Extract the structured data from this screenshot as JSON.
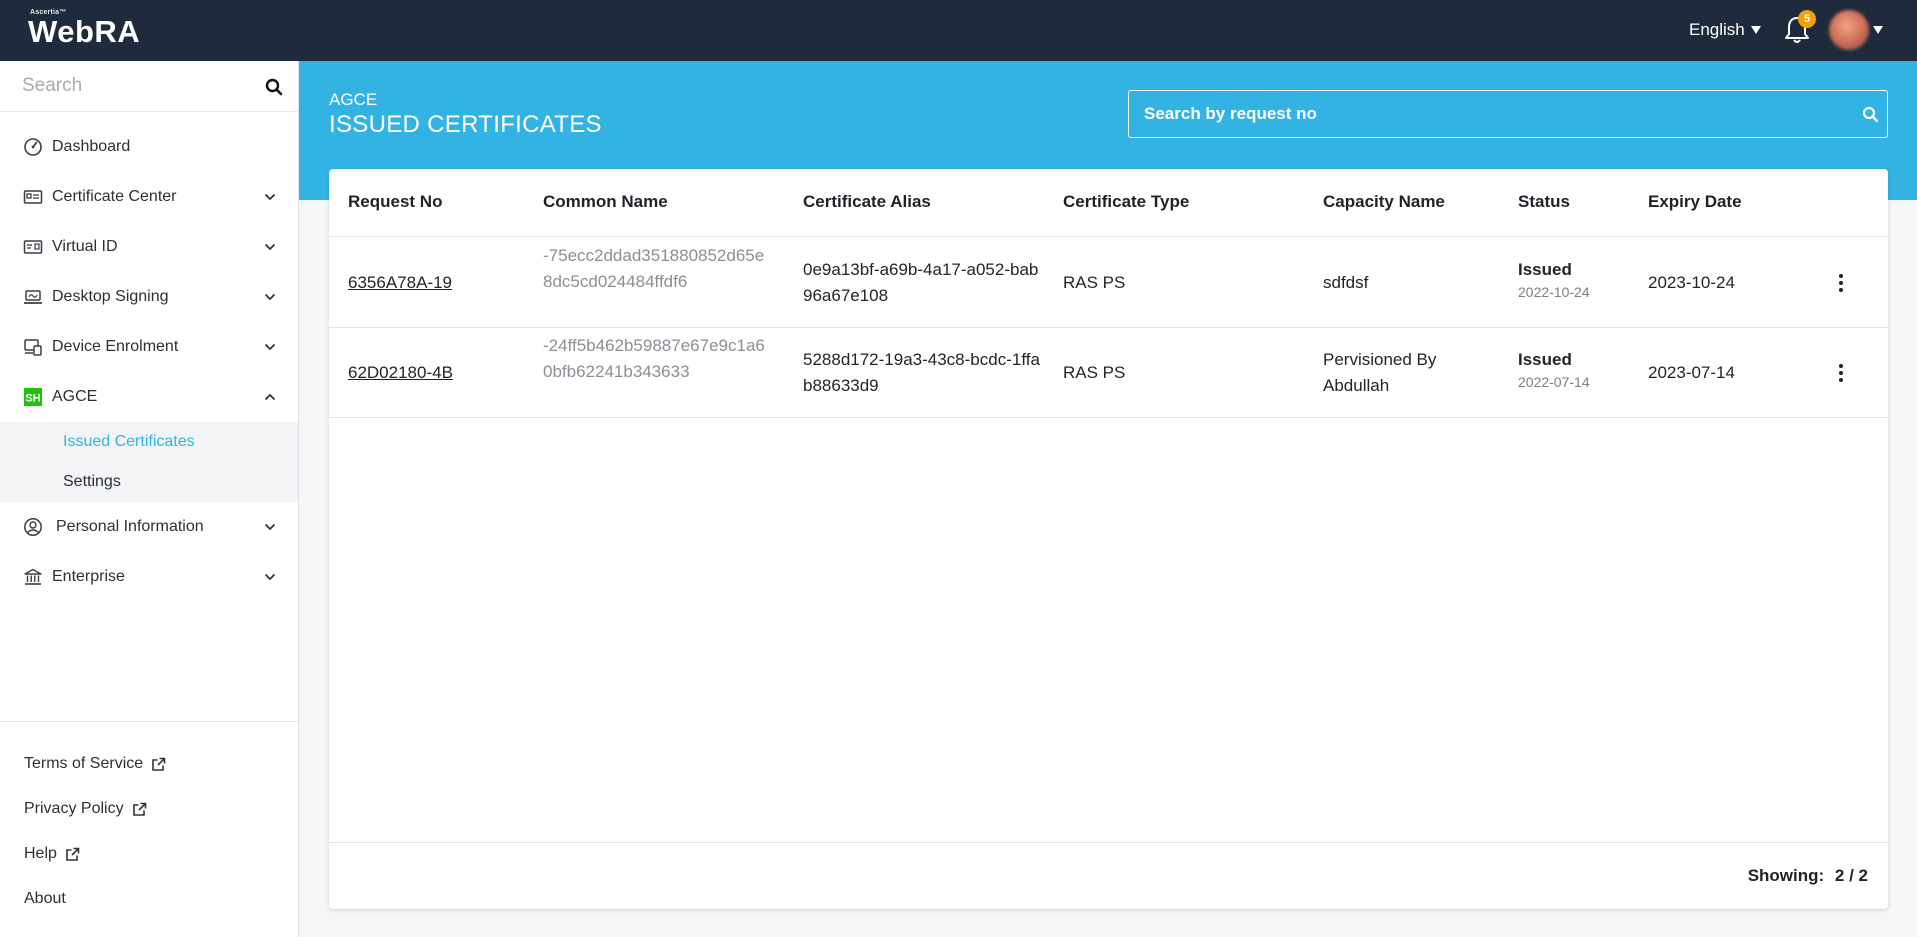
{
  "brand": {
    "small": "Ascertia™",
    "name": "WebRA"
  },
  "topbar": {
    "language": "English",
    "notifications_count": "5",
    "colors": {
      "bg": "#1f2a3c",
      "badge": "#f2a007"
    }
  },
  "sidebar": {
    "search_placeholder": "Search",
    "items": [
      {
        "label": "Dashboard",
        "icon": "dashboard-gauge-icon"
      },
      {
        "label": "Certificate Center",
        "icon": "certificate-card-icon"
      },
      {
        "label": "Virtual ID",
        "icon": "id-card-icon"
      },
      {
        "label": "Desktop Signing",
        "icon": "laptop-signing-icon"
      },
      {
        "label": "Device Enrolment",
        "icon": "device-enrolment-icon"
      },
      {
        "label": "AGCE",
        "icon": "agce-sh-icon"
      },
      {
        "label": "Personal Information",
        "icon": "user-circle-icon"
      },
      {
        "label": "Enterprise",
        "icon": "bank-building-icon"
      }
    ],
    "agce_sub": [
      {
        "label": "Issued Certificates"
      },
      {
        "label": "Settings"
      }
    ],
    "footer": [
      {
        "label": "Terms of Service"
      },
      {
        "label": "Privacy Policy"
      },
      {
        "label": "Help"
      },
      {
        "label": "About"
      }
    ],
    "colors": {
      "active": "#31b5e4",
      "agce_icon": "#22c10f"
    }
  },
  "header": {
    "subtitle": "AGCE",
    "title": "ISSUED CERTIFICATES",
    "search_placeholder": "Search by request no",
    "colors": {
      "band": "#33b3e3"
    }
  },
  "table": {
    "columns": [
      "Request No",
      "Common Name",
      "Certificate Alias",
      "Certificate Type",
      "Capacity Name",
      "Status",
      "Expiry Date"
    ],
    "rows": [
      {
        "request_no": "6356A78A-19",
        "common_name": "-75ecc2ddad351880852d65e8dc5cd024484ffdf6",
        "alias": "0e9a13bf-a69b-4a17-a052-bab96a67e108",
        "type": "RAS PS",
        "capacity": "sdfdsf",
        "status": "Issued",
        "status_date": "2022-10-24",
        "expiry": "2023-10-24"
      },
      {
        "request_no": "62D02180-4B",
        "common_name": "-24ff5b462b59887e67e9c1a60bfb62241b343633",
        "alias": "5288d172-19a3-43c8-bcdc-1ffab88633d9",
        "type": "RAS PS",
        "capacity": "Pervisioned By Abdullah",
        "status": "Issued",
        "status_date": "2022-07-14",
        "expiry": "2023-07-14"
      }
    ],
    "showing_label": "Showing:",
    "showing_value": "2 / 2"
  }
}
